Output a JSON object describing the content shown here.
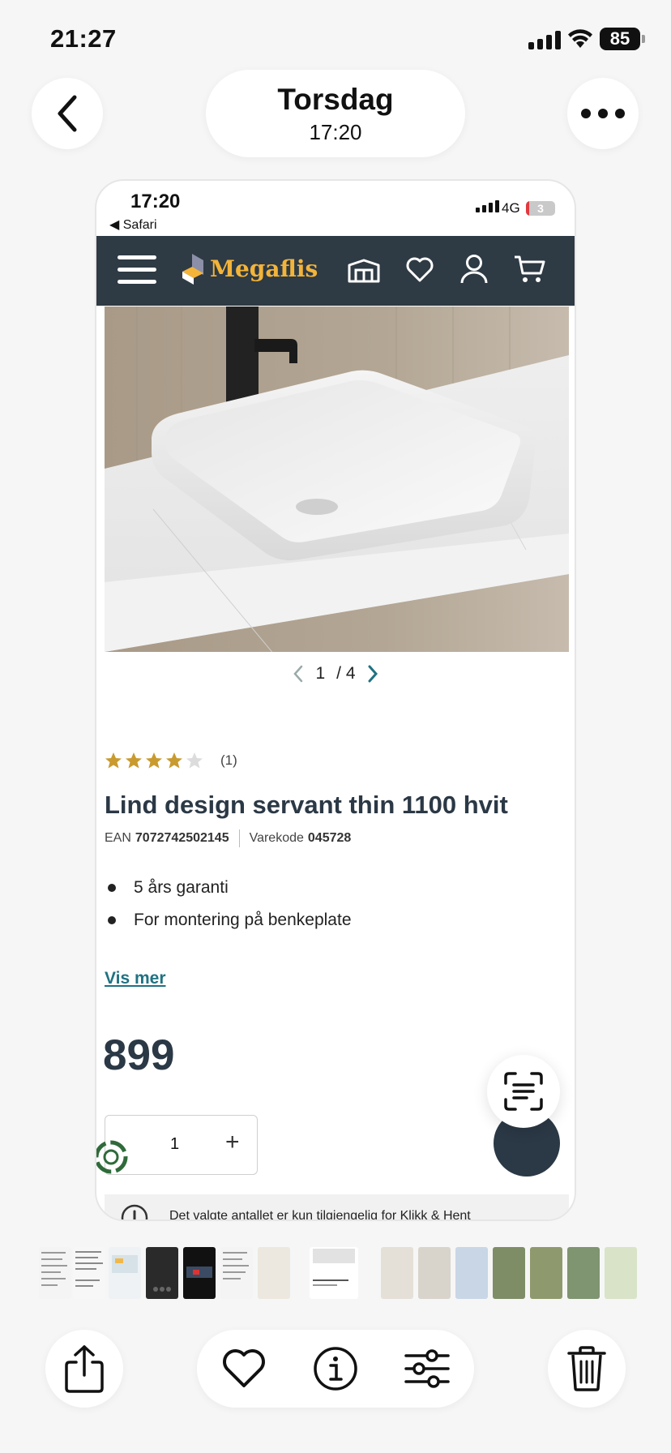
{
  "status_bar": {
    "time": "21:27",
    "battery": "85"
  },
  "photo_header": {
    "day": "Torsdag",
    "time": "17:20"
  },
  "screenshot": {
    "status_bar": {
      "time": "17:20",
      "back_app": "◀ Safari",
      "network": "4G",
      "battery": "3"
    },
    "navbar": {
      "logo": "Megaflis"
    },
    "gallery": {
      "current": "1",
      "total": "/ 4"
    },
    "product": {
      "rating_stars": 4,
      "rating_max": 5,
      "review_count": "(1)",
      "title": "Lind design servant thin 1100 hvit",
      "ean_label": "EAN",
      "ean": "7072742502145",
      "sku_label": "Varekode",
      "sku": "045728",
      "bullets": [
        "5 års garanti",
        "For montering på benkeplate"
      ],
      "show_more": "Vis mer",
      "price": "899",
      "quantity": "1",
      "notice": "Det valgte antallet er kun tilgjengelig for Klikk & Hent"
    },
    "colors": {
      "navbar": "#2e3a44",
      "logo": "#f3b43a",
      "link": "#1f7282",
      "star": "#c99a2e"
    }
  }
}
